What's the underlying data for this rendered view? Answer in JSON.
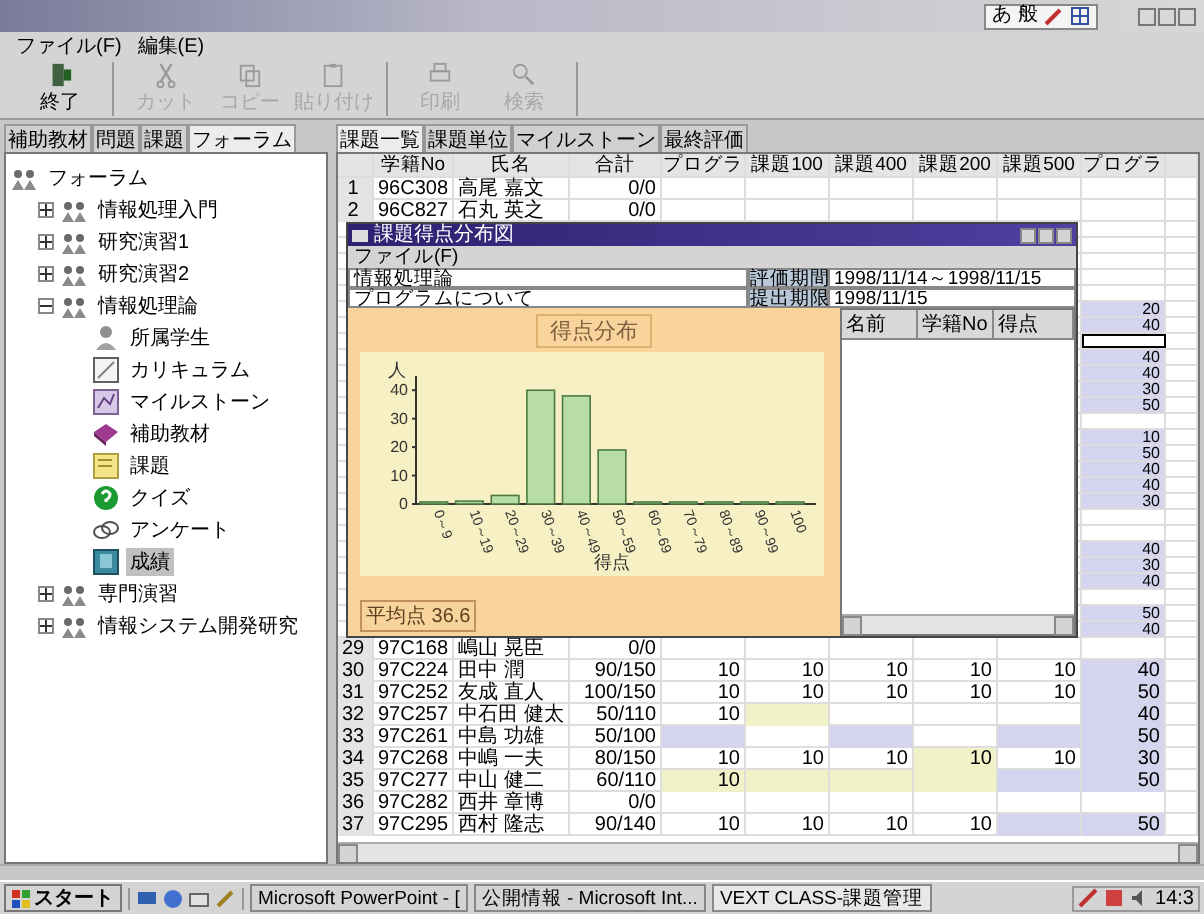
{
  "ime_bar": {
    "items": [
      "あ",
      "般"
    ]
  },
  "menu": [
    "ファイル(F)",
    "編集(E)"
  ],
  "toolbar": [
    [
      {
        "label": "終了",
        "kind": "exit",
        "disabled": false
      }
    ],
    [
      {
        "label": "カット",
        "kind": "cut",
        "disabled": true
      },
      {
        "label": "コピー",
        "kind": "copy",
        "disabled": true
      },
      {
        "label": "貼り付け",
        "kind": "paste",
        "disabled": true
      }
    ],
    [
      {
        "label": "印刷",
        "kind": "print",
        "disabled": true
      },
      {
        "label": "検索",
        "kind": "search",
        "disabled": true
      }
    ]
  ],
  "left_tabs": [
    {
      "label": "補助教材",
      "selected": false
    },
    {
      "label": "問題",
      "selected": false
    },
    {
      "label": "課題",
      "selected": false
    },
    {
      "label": "フォーラム",
      "selected": true
    }
  ],
  "tree": {
    "label": "フォーラム",
    "kind": "group",
    "selected": false,
    "children": [
      {
        "label": "情報処理入門",
        "kind": "group",
        "expanded": false,
        "selected": false
      },
      {
        "label": "研究演習1",
        "kind": "group",
        "expanded": false,
        "selected": false
      },
      {
        "label": "研究演習2",
        "kind": "group",
        "expanded": false,
        "selected": false
      },
      {
        "label": "情報処理論",
        "kind": "group",
        "expanded": true,
        "selected": false,
        "children": [
          {
            "label": "所属学生",
            "kind": "students",
            "selected": false
          },
          {
            "label": "カリキュラム",
            "kind": "curriculum",
            "selected": false
          },
          {
            "label": "マイルストーン",
            "kind": "milestone",
            "selected": false
          },
          {
            "label": "補助教材",
            "kind": "material",
            "selected": false
          },
          {
            "label": "課題",
            "kind": "assignment",
            "selected": false
          },
          {
            "label": "クイズ",
            "kind": "quiz",
            "selected": false
          },
          {
            "label": "アンケート",
            "kind": "survey",
            "selected": false
          },
          {
            "label": "成績",
            "kind": "grades",
            "selected": true
          }
        ]
      },
      {
        "label": "専門演習",
        "kind": "group",
        "expanded": false,
        "selected": false
      },
      {
        "label": "情報システム開発研究",
        "kind": "group",
        "expanded": false,
        "selected": false
      }
    ]
  },
  "right_tabs": [
    {
      "label": "課題一覧",
      "selected": true
    },
    {
      "label": "課題単位",
      "selected": false
    },
    {
      "label": "マイルストーン",
      "selected": false
    },
    {
      "label": "最終評価",
      "selected": false
    }
  ],
  "table": {
    "columns": [
      "学籍No",
      "氏名",
      "合計",
      "プログラ",
      "課題100",
      "課題400",
      "課題200",
      "課題500",
      "プログラ"
    ],
    "rows": [
      {
        "no": "1",
        "id": "96C308",
        "name": "高尾 嘉文",
        "total": "0/0",
        "selected": false,
        "cells": [
          {},
          {},
          {},
          {},
          {},
          {}
        ]
      },
      {
        "no": "2",
        "id": "96C827",
        "name": "石丸 英之",
        "total": "0/0",
        "selected": false,
        "cells": [
          {},
          {},
          {},
          {},
          {},
          {}
        ]
      },
      {
        "selected": false
      },
      {
        "selected": false
      },
      {
        "selected": false
      },
      {
        "selected": false
      },
      {
        "selected": false
      },
      {
        "selected": false,
        "last": {
          "text": "20",
          "color": "#d4d4ee"
        }
      },
      {
        "selected": false,
        "last": {
          "text": "40",
          "color": "#d4d4ee"
        }
      },
      {
        "selected": true
      },
      {
        "selected": false,
        "last": {
          "text": "40",
          "color": "#d4d4ee"
        }
      },
      {
        "selected": false,
        "last": {
          "text": "40",
          "color": "#d4d4ee"
        }
      },
      {
        "selected": false,
        "last": {
          "text": "30",
          "color": "#d4d4ee"
        }
      },
      {
        "selected": false,
        "last": {
          "text": "50",
          "color": "#d4d4ee"
        }
      },
      {
        "selected": false
      },
      {
        "selected": false,
        "last": {
          "text": "10",
          "color": "#d4d4ee"
        }
      },
      {
        "selected": false,
        "last": {
          "text": "50",
          "color": "#d4d4ee"
        }
      },
      {
        "selected": false,
        "last": {
          "text": "40",
          "color": "#d4d4ee"
        }
      },
      {
        "selected": false,
        "last": {
          "text": "40",
          "color": "#d4d4ee"
        }
      },
      {
        "selected": false,
        "last": {
          "text": "30",
          "color": "#d4d4ee"
        }
      },
      {
        "selected": false
      },
      {
        "selected": false
      },
      {
        "selected": false,
        "last": {
          "text": "40",
          "color": "#d4d4ee"
        }
      },
      {
        "selected": false,
        "last": {
          "text": "30",
          "color": "#d4d4ee"
        }
      },
      {
        "selected": false,
        "last": {
          "text": "40",
          "color": "#d4d4ee"
        }
      },
      {
        "selected": false
      },
      {
        "selected": false,
        "last": {
          "text": "50",
          "color": "#d4d4ee"
        }
      },
      {
        "selected": false,
        "last": {
          "text": "40",
          "color": "#d4d4ee"
        }
      },
      {
        "no": "29",
        "id": "97C168",
        "name": "嶋山 晃臣",
        "total": "0/0",
        "selected": false,
        "cells": [
          {},
          {},
          {},
          {},
          {},
          {}
        ]
      },
      {
        "no": "30",
        "id": "97C224",
        "name": "田中 潤",
        "total": "90/150",
        "selected": false,
        "cells": [
          {
            "text": "10"
          },
          {
            "text": "10"
          },
          {
            "text": "10"
          },
          {
            "text": "10"
          },
          {
            "text": "10"
          },
          {
            "text": "40",
            "color": "#d4d4ee"
          }
        ]
      },
      {
        "no": "31",
        "id": "97C252",
        "name": "友成 直人",
        "total": "100/150",
        "selected": false,
        "cells": [
          {
            "text": "10"
          },
          {
            "text": "10"
          },
          {
            "text": "10"
          },
          {
            "text": "10"
          },
          {
            "text": "10"
          },
          {
            "text": "50",
            "color": "#d4d4ee"
          }
        ]
      },
      {
        "no": "32",
        "id": "97C257",
        "name": "中石田 健太",
        "total": "50/110",
        "selected": false,
        "cells": [
          {
            "text": "10"
          },
          {
            "color": "#f2f2c8"
          },
          {},
          {},
          {},
          {
            "text": "40",
            "color": "#d4d4ee"
          }
        ]
      },
      {
        "no": "33",
        "id": "97C261",
        "name": "中島 功雄",
        "total": "50/100",
        "selected": false,
        "cells": [
          {
            "color": "#d4d4ee"
          },
          {},
          {
            "color": "#d4d4ee"
          },
          {},
          {
            "color": "#d4d4ee"
          },
          {
            "text": "50",
            "color": "#d4d4ee"
          }
        ]
      },
      {
        "no": "34",
        "id": "97C268",
        "name": "中嶋 一夫",
        "total": "80/150",
        "selected": false,
        "cells": [
          {
            "text": "10"
          },
          {
            "text": "10"
          },
          {
            "text": "10"
          },
          {
            "text": "10",
            "color": "#f2f2c8"
          },
          {
            "text": "10"
          },
          {
            "text": "30",
            "color": "#d4d4ee"
          }
        ]
      },
      {
        "no": "35",
        "id": "97C277",
        "name": "中山 健二",
        "total": "60/110",
        "selected": false,
        "cells": [
          {
            "text": "10",
            "color": "#f2f2c8"
          },
          {
            "color": "#f2f2c8"
          },
          {
            "color": "#f2f2c8"
          },
          {
            "color": "#f2f2c8"
          },
          {
            "color": "#d4d4ee"
          },
          {
            "text": "50",
            "color": "#d4d4ee"
          }
        ]
      },
      {
        "no": "36",
        "id": "97C282",
        "name": "西井 章博",
        "total": "0/0",
        "selected": false,
        "cells": [
          {},
          {},
          {},
          {},
          {},
          {}
        ]
      },
      {
        "no": "37",
        "id": "97C295",
        "name": "西村 隆志",
        "total": "90/140",
        "selected": false,
        "cells": [
          {
            "text": "10"
          },
          {
            "text": "10"
          },
          {
            "text": "10"
          },
          {
            "text": "10"
          },
          {
            "color": "#d4d4ee"
          },
          {
            "text": "50",
            "color": "#d4d4ee"
          }
        ]
      }
    ]
  },
  "dialog": {
    "title": "課題得点分布図",
    "menu": [
      "ファイル(F)"
    ],
    "course": "情報処理論",
    "assignment": "プログラムについて",
    "fields": [
      {
        "label": "評価期間",
        "value": "1998/11/14～1998/11/15"
      },
      {
        "label": "提出期限",
        "value": "1998/11/15"
      }
    ],
    "panel_title": "得点分布",
    "chart_data": {
      "type": "bar",
      "xlabel": "得点",
      "ylabel": "人",
      "categories": [
        "0～9",
        "10～19",
        "20～29",
        "30～39",
        "40～49",
        "50～59",
        "60～69",
        "70～79",
        "80～89",
        "90～99",
        "100"
      ],
      "values": [
        0,
        1,
        3,
        40,
        38,
        19,
        0,
        0,
        0,
        0,
        0
      ],
      "ylim": [
        0,
        45
      ],
      "yticks": [
        0,
        10,
        20,
        30,
        40
      ]
    },
    "average": "平均点 36.6",
    "list_columns": [
      "名前",
      "学籍No",
      "得点"
    ]
  },
  "taskbar": {
    "start": "スタート",
    "tasks": [
      "Microsoft PowerPoint - [",
      "公開情報 - Microsoft Int...",
      "VEXT CLASS-課題管理"
    ],
    "time": "14:3"
  }
}
